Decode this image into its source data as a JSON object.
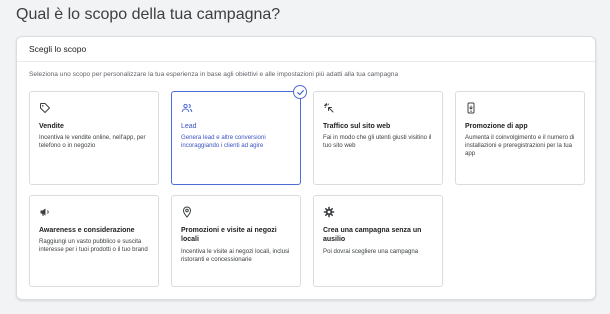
{
  "page": {
    "title": "Qual è lo scopo della tua campagna?"
  },
  "panel": {
    "header": "Scegli lo scopo",
    "description": "Seleziona uno scopo per personalizzare la tua esperienza in base agli obiettivi e alle impostazioni più adatti alla tua campagna"
  },
  "colors": {
    "accent": "#4d6bd6",
    "icon": "#3c4043"
  },
  "goals": [
    {
      "icon": "tag-icon",
      "title": "Vendite",
      "desc": "Incentiva le vendite online, nell'app, per telefono o in negozio",
      "selected": false
    },
    {
      "icon": "people-icon",
      "title": "Lead",
      "desc": "Genera lead e altre conversioni incoraggiando i clienti ad agire",
      "selected": true
    },
    {
      "icon": "cursor-click-icon",
      "title": "Traffico sul sito web",
      "desc": "Fai in modo che gli utenti giusti visitino il tuo sito web",
      "selected": false
    },
    {
      "icon": "mobile-app-icon",
      "title": "Promozione di app",
      "desc": "Aumenta il coinvolgimento e il numero di installazioni e preregistrazioni per la tua app",
      "selected": false
    },
    {
      "icon": "megaphone-icon",
      "title": "Awareness e considerazione",
      "desc": "Raggiungi un vasto pubblico e suscita interesse per i tuoi prodotti o il tuo brand",
      "selected": false
    },
    {
      "icon": "location-pin-icon",
      "title": "Promozioni e visite ai negozi locali",
      "desc": "Incentiva le visite ai negozi locali, inclusi ristoranti e concessionarie",
      "selected": false
    },
    {
      "icon": "gear-icon",
      "title": "Crea una campagna senza un ausilio",
      "desc": "Poi dovrai scegliere una campagna",
      "selected": false
    }
  ]
}
